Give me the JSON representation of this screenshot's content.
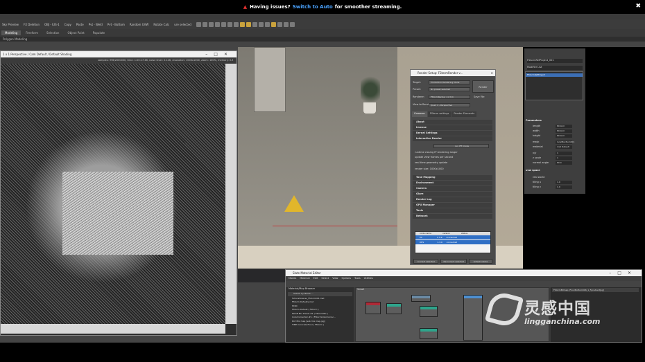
{
  "banner": {
    "prefix": "Having issues?",
    "link": "Switch to Auto",
    "suffix": "for smoother streaming.",
    "close": "✖"
  },
  "toolbar": {
    "items": [
      "Sky Preview",
      "FX Deletion",
      "OBJ - IUS-1",
      "Copy",
      "Paste",
      "Pvt - Weld",
      "Pvt - Bottom",
      "Random UVW",
      "Rotate Calc"
    ],
    "selection": "ure selected"
  },
  "ribbon": {
    "tabs": [
      "Modeling",
      "Freeform",
      "Selection",
      "Object Paint",
      "Populate"
    ],
    "active": "Modeling",
    "sub": "Polygon Modeling"
  },
  "vfb": {
    "title": "1 x 1 Perspective / Cam Default / Default Shading",
    "tool_text": "samples: 996/2000000, time: 1:00:17:46, noise level: 0.126, resolution: 1000x1000, zoom: 100%, memory: 0.3"
  },
  "render_setup": {
    "title": "Render Setup: FStormRender v...",
    "target_label": "Target:",
    "target_value": "Production Rendering Mode",
    "preset_label": "Preset:",
    "preset_value": "No preset selected",
    "renderer_label": "Renderer:",
    "renderer_value": "FStormRender v1.3.9i",
    "save_file": "Save File",
    "view_label": "View to Render:",
    "view_value": "Quad 4 - Perspective",
    "render_button": "Render",
    "tabs": [
      "Common",
      "FStorm settings",
      "Render Elements"
    ],
    "sections": [
      "About",
      "License",
      "Kernel Settings",
      "Interactive Render",
      "Tone Mapping",
      "Environment",
      "Camera",
      "Glare",
      "Render Log",
      "GPU Manager",
      "Tools",
      "Network"
    ],
    "ir_button": "run IFT mode",
    "ir_rows": [
      "runtime closing IP rendering longer",
      "update view frames per second",
      "real time geometry update",
      "render size: 1000x1000"
    ],
    "network_cols": [
      "node name",
      "version",
      "status"
    ],
    "network_rows": [
      {
        "name": "PC",
        "version": "1.3.9",
        "status": "connected"
      },
      {
        "name": "DES",
        "version": "1.3.9",
        "status": "connected"
      }
    ],
    "footer_buttons": [
      "connect selected",
      "disconnect selected",
      "refresh status"
    ]
  },
  "command_panel": {
    "object_name": "FStormRefProject_001",
    "modifier_list": "Modifier List",
    "stack_item": "FStormRefProject",
    "parameters": "Parameters",
    "params": [
      {
        "label": "length",
        "value": "80.0cm"
      },
      {
        "label": "width",
        "value": "80.0cm"
      },
      {
        "label": "height",
        "value": "80.0cm"
      },
      {
        "label": "mask",
        "value": "localBoxNum001"
      },
      {
        "label": "material",
        "value": "mat Default"
      },
      {
        "label": "x/y",
        "value": "1"
      },
      {
        "label": "z scale",
        "value": "1"
      },
      {
        "label": "normal angle",
        "value": "80.0"
      }
    ],
    "uvw_section": "uvw space",
    "uvw_params": [
      {
        "label": "real world",
        "value": ""
      },
      {
        "label": "tiling u",
        "value": "1.0"
      },
      {
        "label": "tiling v",
        "value": "1.0"
      }
    ]
  },
  "sme": {
    "title": "Slate Material Editor",
    "menu": [
      "Modes",
      "Material",
      "Edit",
      "Select",
      "View",
      "Options",
      "Tools",
      "Utilities"
    ],
    "browser_title": "Material/Map Browser",
    "search": "Search by Name ...",
    "browser_items": [
      "TutorialScenes_FStorm001.mat",
      "FStorm Defaults.mat",
      "HDRI",
      "FStorm Default ( FStorm )",
      "Falloff Mix Preset #1 ( FStormMix )",
      "ColorCorrection #1 ( FStormColorCorrec...",
      "Dirt Mix map [sub mix map.jpg]",
      "TIMP Concrete Floor ( FStorm )"
    ],
    "view_label": "View1",
    "path": "FStormBitmap [FloorBottom006_1_FgradientJpg]"
  },
  "watermark": {
    "main": "灵感中国",
    "sub": "lingganchina.com"
  }
}
